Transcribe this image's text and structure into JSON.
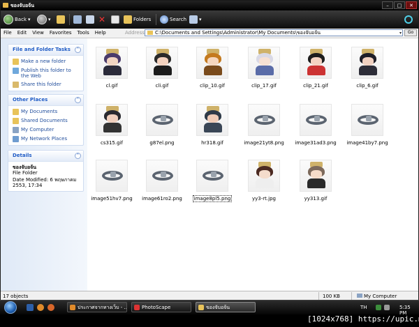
{
  "window": {
    "title": "ของจับอจ้น",
    "controls": {
      "minimize": "–",
      "maximize": "□",
      "close": "✕"
    }
  },
  "toolbar": {
    "back_label": "Back",
    "folders_label": "Folders",
    "search_label": "Search"
  },
  "menubar": {
    "items": [
      "File",
      "Edit",
      "View",
      "Favorites",
      "Tools",
      "Help"
    ],
    "address_label": "Address",
    "address_value": "C:\\Documents and Settings\\Administrator\\My Documents\\ของจับอจ้น",
    "go_label": "Go"
  },
  "tasks_panel": {
    "title": "File and Folder Tasks",
    "items": [
      "Make a new folder",
      "Publish this folder to the Web",
      "Share this folder"
    ]
  },
  "places_panel": {
    "title": "Other Places",
    "items": [
      "My Documents",
      "Shared Documents",
      "My Computer",
      "My Network Places"
    ]
  },
  "details_panel": {
    "title": "Details",
    "name": "ของจับอจ้น",
    "type": "File Folder",
    "modified": "Date Modified: 6 พฤษภาคม 2553, 17:34"
  },
  "files": [
    {
      "name": "cl.gif",
      "kind": "figure"
    },
    {
      "name": "cli.gif",
      "kind": "figure"
    },
    {
      "name": "clip_10.gif",
      "kind": "figure"
    },
    {
      "name": "clip_17.gif",
      "kind": "figure"
    },
    {
      "name": "clip_21.gif",
      "kind": "figure"
    },
    {
      "name": "clip_6.gif",
      "kind": "figure"
    },
    {
      "name": "cs315.gif",
      "kind": "figure"
    },
    {
      "name": "g87el.png",
      "kind": "ring"
    },
    {
      "name": "hr318.gif",
      "kind": "figure"
    },
    {
      "name": "image21yt8.png",
      "kind": "ring"
    },
    {
      "name": "image31ad3.png",
      "kind": "ring"
    },
    {
      "name": "image41by7.png",
      "kind": "ring"
    },
    {
      "name": "image51hv7.png",
      "kind": "ring"
    },
    {
      "name": "image61ro2.png",
      "kind": "ring"
    },
    {
      "name": "image8pl5.png",
      "kind": "ring",
      "selected": true
    },
    {
      "name": "yy3-rt.jpg",
      "kind": "figure"
    },
    {
      "name": "yy313.gif",
      "kind": "figure"
    }
  ],
  "statusbar": {
    "count": "17 objects",
    "size": "100 KB",
    "location": "My Computer"
  },
  "taskbar": {
    "tasks": [
      "ประกาศจากทางเว็บ - ...",
      "PhotoScape",
      "ของจับอจ้น"
    ],
    "lang": "TH",
    "time": "5:35 PM"
  },
  "watermark": "[1024x768] https://upic.me/"
}
